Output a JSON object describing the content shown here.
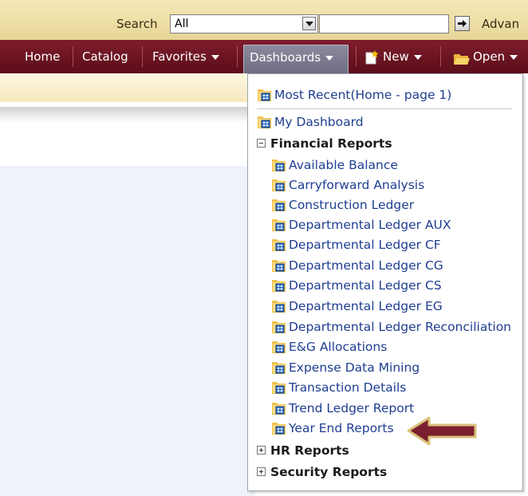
{
  "search": {
    "label": "Search",
    "scope_value": "All",
    "advanced_label": "Advan"
  },
  "nav": {
    "items": [
      "Home",
      "Catalog",
      "Favorites",
      "Dashboards",
      "New",
      "Open"
    ]
  },
  "menu": {
    "recent": "Most Recent(Home - page 1)",
    "my_dashboard": "My Dashboard",
    "financial_header": "Financial Reports",
    "financial_items": [
      "Available Balance",
      "Carryforward Analysis",
      "Construction Ledger",
      "Departmental Ledger AUX",
      "Departmental Ledger CF",
      "Departmental Ledger CG",
      "Departmental Ledger CS",
      "Departmental Ledger EG",
      "Departmental Ledger Reconciliation",
      "E&G Allocations",
      "Expense Data Mining",
      "Transaction Details",
      "Trend Ledger Report",
      "Year End Reports"
    ],
    "hr_header": "HR Reports",
    "security_header": "Security Reports"
  },
  "colors": {
    "nav_background": "#6d1424",
    "link_blue": "#1f3e91",
    "highlight_arrow": "#7b1f2e"
  },
  "icons": [
    "dashboard-icon",
    "go-arrow-icon",
    "new-icon",
    "folder-open-icon",
    "expand-icon",
    "collapse-icon",
    "pointer-arrow-icon"
  ]
}
